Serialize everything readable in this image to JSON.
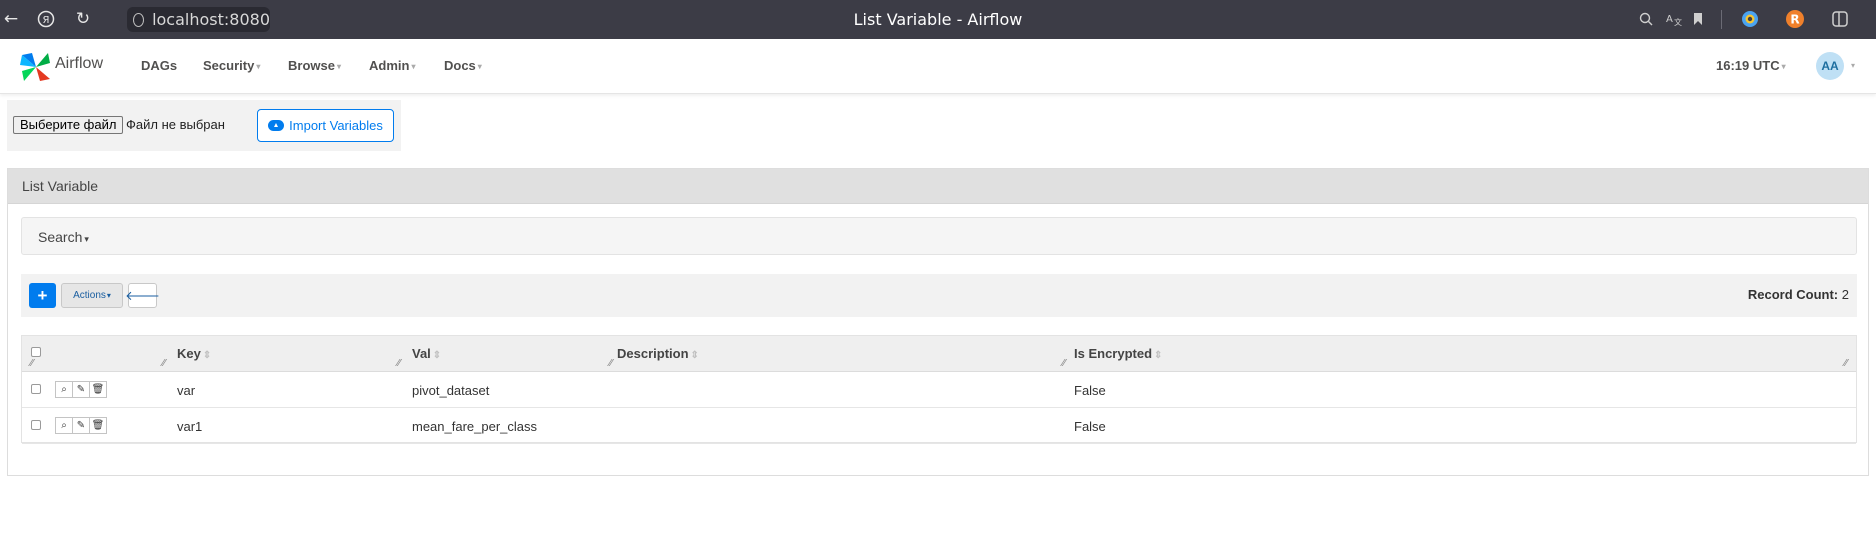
{
  "browser": {
    "url": "localhost:8080",
    "window_title": "List Variable - Airflow"
  },
  "navbar": {
    "brand": "Airflow",
    "items": [
      {
        "label": "DAGs"
      },
      {
        "label": "Security"
      },
      {
        "label": "Browse"
      },
      {
        "label": "Admin"
      },
      {
        "label": "Docs"
      }
    ],
    "clock": "16:19 UTC",
    "avatar": "AA"
  },
  "import": {
    "file_button": "Выберите файл",
    "file_status": "Файл не выбран",
    "import_button": "Import Variables"
  },
  "panel": {
    "title": "List Variable",
    "search_label": "Search",
    "actions_label": "Actions",
    "add_label": "+",
    "record_count_label": "Record Count:",
    "record_count_value": "2"
  },
  "table": {
    "columns": [
      "Key",
      "Val",
      "Description",
      "Is Encrypted"
    ],
    "rows": [
      {
        "key": "var",
        "val": "pivot_dataset",
        "description": "",
        "is_encrypted": "False"
      },
      {
        "key": "var1",
        "val": "mean_fare_per_class",
        "description": "",
        "is_encrypted": "False"
      }
    ]
  },
  "colors": {
    "accent": "#017cee",
    "browser_chrome": "#3c3c46",
    "panel_header": "#e0e0e0"
  }
}
